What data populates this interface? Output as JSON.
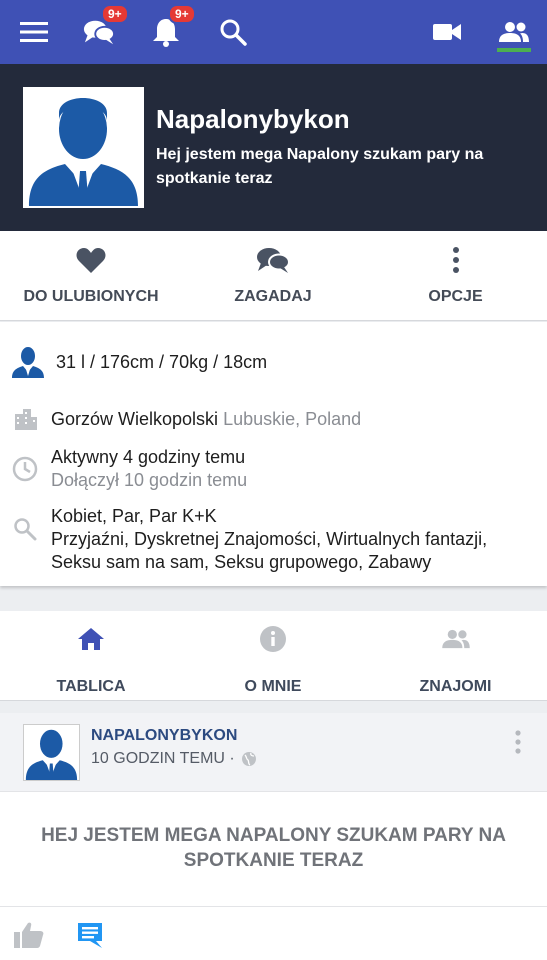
{
  "topbar": {
    "messages_badge": "9+",
    "notifications_badge": "9+",
    "icons": [
      "menu-icon",
      "chat-icon",
      "bell-icon",
      "search-icon",
      "video-icon",
      "people-icon"
    ],
    "colors": {
      "bar": "#3f51b5",
      "badge": "#e53935",
      "active": "#4caf50"
    }
  },
  "profile": {
    "name": "Napalonybykon",
    "bio": "Hej jestem mega Napalony szukam pary na spotkanie teraz"
  },
  "actions": [
    {
      "label": "DO ULUBIONYCH",
      "icon": "heart-icon"
    },
    {
      "label": "ZAGADAJ",
      "icon": "chat-icon"
    },
    {
      "label": "OPCJE",
      "icon": "more-vert-icon"
    }
  ],
  "info": {
    "stats": "31 l / 176cm / 70kg / 18cm",
    "city": "Gorzów Wielkopolski",
    "region": "Lubuskie, Poland",
    "active": "Aktywny 4 godziny temu",
    "joined": "Dołączył 10 godzin temu",
    "looking_for": "Kobiet, Par, Par K+K",
    "interests": "Przyjaźni, Dyskretnej Znajomości, Wirtualnych fantazji, Seksu sam na sam, Seksu grupowego, Zabawy"
  },
  "tabs": [
    {
      "label": "TABLICA",
      "icon": "home-icon"
    },
    {
      "label": "O MNIE",
      "icon": "info-icon"
    },
    {
      "label": "ZNAJOMI",
      "icon": "people-icon"
    }
  ],
  "post": {
    "author": "NAPALONYBYKON",
    "time": "10 GODZIN TEMU ·",
    "body": "HEJ JESTEM MEGA NAPALONY SZUKAM PARY NA SPOTKANIE TERAZ"
  }
}
